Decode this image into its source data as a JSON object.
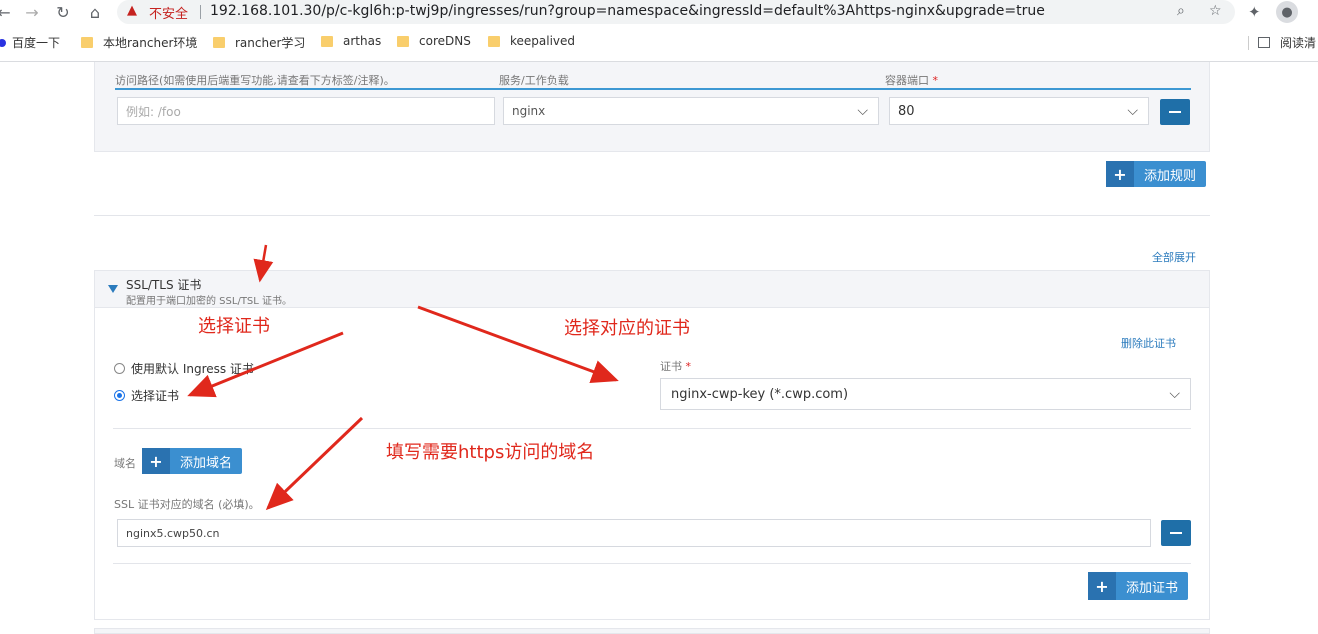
{
  "browser": {
    "security_label": "不安全",
    "url": "192.168.101.30/p/c-kgl6h:p-twj9p/ingresses/run?group=namespace&ingressId=default%3Ahttps-nginx&upgrade=true",
    "bookmarks": [
      {
        "label": "百度一下",
        "icon": "baidu-icon"
      },
      {
        "label": "本地rancher环境",
        "icon": "folder-icon"
      },
      {
        "label": "rancher学习",
        "icon": "folder-icon"
      },
      {
        "label": "arthas",
        "icon": "folder-icon"
      },
      {
        "label": "coreDNS",
        "icon": "folder-icon"
      },
      {
        "label": "keepalived",
        "icon": "folder-icon"
      }
    ],
    "reading_list": "阅读清"
  },
  "rules": {
    "path_header": "访问路径(如需使用后端重写功能,请查看下方标签/注释)。",
    "service_header": "服务/工作负载",
    "port_header": "容器端口",
    "required_mark": "*",
    "path_placeholder": "例如: /foo",
    "service_value": "nginx",
    "port_value": "80",
    "add_rule_label": "添加规则"
  },
  "ssl": {
    "expand_all": "全部展开",
    "title": "SSL/TLS 证书",
    "subtitle": "配置用于端口加密的 SSL/TSL 证书。",
    "delete_cert": "删除此证书",
    "radio_default": "使用默认 Ingress 证书",
    "radio_choose": "选择证书",
    "cert_label": "证书",
    "cert_value": "nginx-cwp-key (*.cwp.com)",
    "domain_label": "域名",
    "add_domain": "添加域名",
    "domain_hint": "SSL 证书对应的域名 (必填)。",
    "domain_value": "nginx5.cwp50.cn",
    "add_cert": "添加证书"
  },
  "annotations": {
    "choose_cert": "选择证书",
    "choose_matching_cert": "选择对应的证书",
    "fill_domain": "填写需要https访问的域名"
  },
  "colors": {
    "accent": "#3b8fd0",
    "accent_dark": "#1f6fa8",
    "annotation": "#e0281c"
  }
}
